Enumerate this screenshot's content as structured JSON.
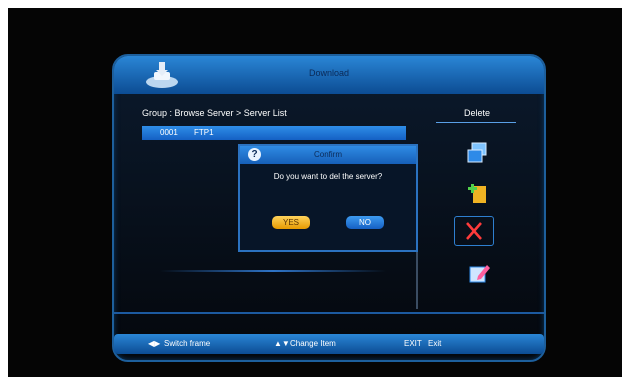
{
  "window": {
    "title": "Download"
  },
  "path": {
    "text": "Group : Browse Server > Server List"
  },
  "side": {
    "heading": "Delete",
    "icons": [
      "copy-icon",
      "add-icon",
      "delete-x-icon",
      "edit-icon"
    ]
  },
  "list": {
    "rows": [
      {
        "num": "0001",
        "name": "FTP1"
      }
    ]
  },
  "dialog": {
    "title": "Confirm",
    "message": "Do you want to del the server?",
    "yes": "YES",
    "no": "NO"
  },
  "footer": {
    "switch_glyph": "◀▶",
    "switch": "Switch frame",
    "change_glyph": "▲▼",
    "change": "Change Item",
    "exit_key": "EXIT",
    "exit": "Exit"
  },
  "colors": {
    "accent": "#1f7fd9",
    "yes_button": "#f0b323",
    "delete_x": "#ff3b3b"
  }
}
